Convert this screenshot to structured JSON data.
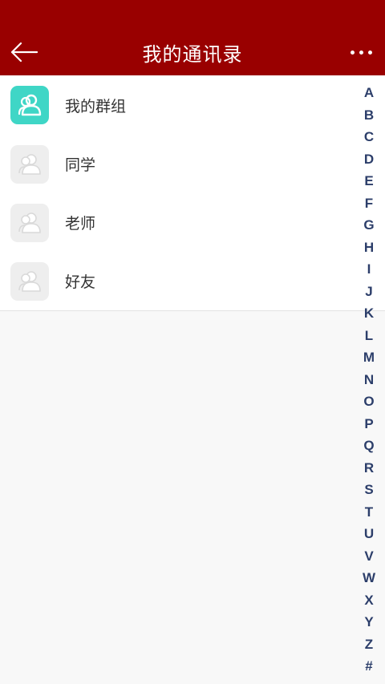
{
  "header": {
    "back_icon": "arrow-left-icon",
    "title": "我的通讯录",
    "more_icon": "more-horizontal-icon"
  },
  "colors": {
    "header_bg": "#990000",
    "active_avatar": "#3fd6c6",
    "inactive_avatar": "#eeeeee",
    "index_letter": "#2c3e6a"
  },
  "contacts": {
    "items": [
      {
        "label": "我的群组",
        "icon": "contacts-group-icon",
        "highlighted": true
      },
      {
        "label": "同学",
        "icon": "contacts-group-icon",
        "highlighted": false
      },
      {
        "label": "老师",
        "icon": "contacts-group-icon",
        "highlighted": false
      },
      {
        "label": "好友",
        "icon": "contacts-group-icon",
        "highlighted": false
      }
    ]
  },
  "index": {
    "letters": [
      "A",
      "B",
      "C",
      "D",
      "E",
      "F",
      "G",
      "H",
      "I",
      "J",
      "K",
      "L",
      "M",
      "N",
      "O",
      "P",
      "Q",
      "R",
      "S",
      "T",
      "U",
      "V",
      "W",
      "X",
      "Y",
      "Z",
      "#"
    ]
  }
}
